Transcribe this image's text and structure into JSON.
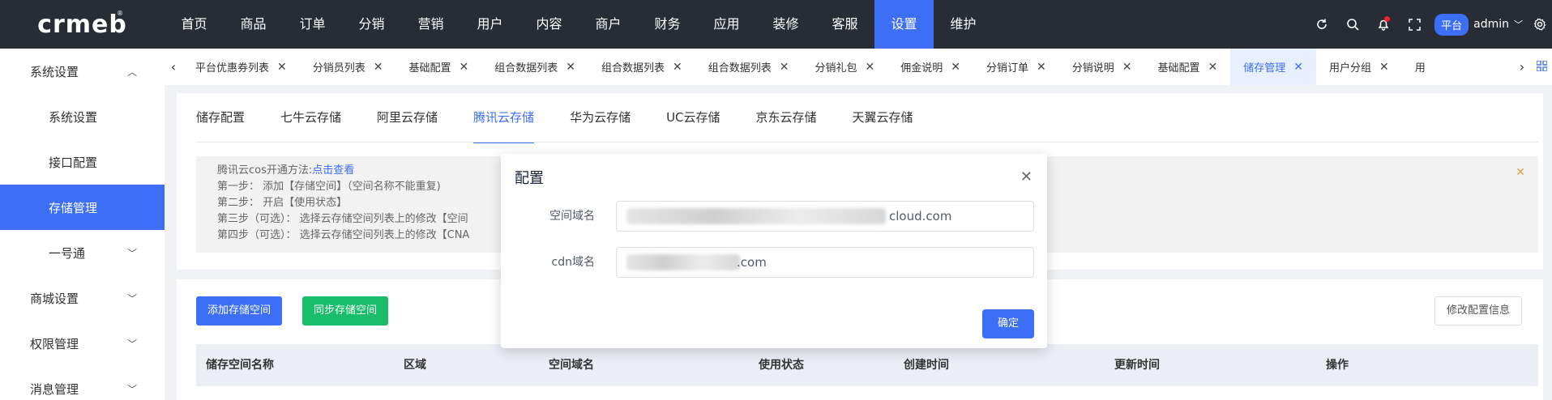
{
  "logo": {
    "text": "crmeb",
    "mark": "®"
  },
  "topnav": {
    "items": [
      "首页",
      "商品",
      "订单",
      "分销",
      "营销",
      "用户",
      "内容",
      "商户",
      "财务",
      "应用",
      "装修",
      "客服",
      "设置",
      "维护"
    ],
    "active_index": 12,
    "platform_label": "平台",
    "user_label": "admin"
  },
  "sidebar": {
    "items": [
      {
        "label": "系统设置",
        "type": "group",
        "expanded": true
      },
      {
        "label": "系统设置",
        "type": "sub"
      },
      {
        "label": "接口配置",
        "type": "sub"
      },
      {
        "label": "存储管理",
        "type": "sub",
        "active": true
      },
      {
        "label": "一号通",
        "type": "sub",
        "expandable": true
      },
      {
        "label": "商城设置",
        "type": "group"
      },
      {
        "label": "权限管理",
        "type": "group"
      },
      {
        "label": "消息管理",
        "type": "group"
      }
    ]
  },
  "tabs": {
    "items": [
      "平台优惠券列表",
      "分销员列表",
      "基础配置",
      "组合数据列表",
      "组合数据列表",
      "组合数据列表",
      "分销礼包",
      "佣金说明",
      "分销订单",
      "分销说明",
      "基础配置",
      "储存管理",
      "用户分组",
      "用"
    ],
    "active_index": 11
  },
  "storage_tabs": {
    "items": [
      "储存配置",
      "七牛云存储",
      "阿里云存储",
      "腾讯云存储",
      "华为云存储",
      "UC云存储",
      "京东云存储",
      "天翼云存储"
    ],
    "active_index": 3
  },
  "notice": {
    "line0_prefix": "腾讯云cos开通方法:",
    "line0_link": "点击查看",
    "line1": "第一步：  添加【存储空间】（空间名称不能重复)",
    "line2": "第二步：  开启【使用状态】",
    "line3": "第三步（可选）：  选择云存储空间列表上的修改【空间",
    "line4": "第四步（可选）：  选择云存储空间列表上的修改【CNA"
  },
  "actions": {
    "add_label": "添加存储空间",
    "sync_label": "同步存储空间",
    "edit_label": "修改配置信息"
  },
  "table": {
    "headers": [
      "储存空间名称",
      "区域",
      "空间域名",
      "使用状态",
      "创建时间",
      "更新时间",
      "操作"
    ]
  },
  "modal": {
    "title": "配置",
    "domain_label": "空间域名",
    "domain_value": "cloud.com",
    "cdn_label": "cdn域名",
    "cdn_value": ".com",
    "confirm_label": "确定"
  },
  "colors": {
    "primary": "#3c6ff5",
    "success": "#19be6b",
    "topbar": "#282c34"
  }
}
